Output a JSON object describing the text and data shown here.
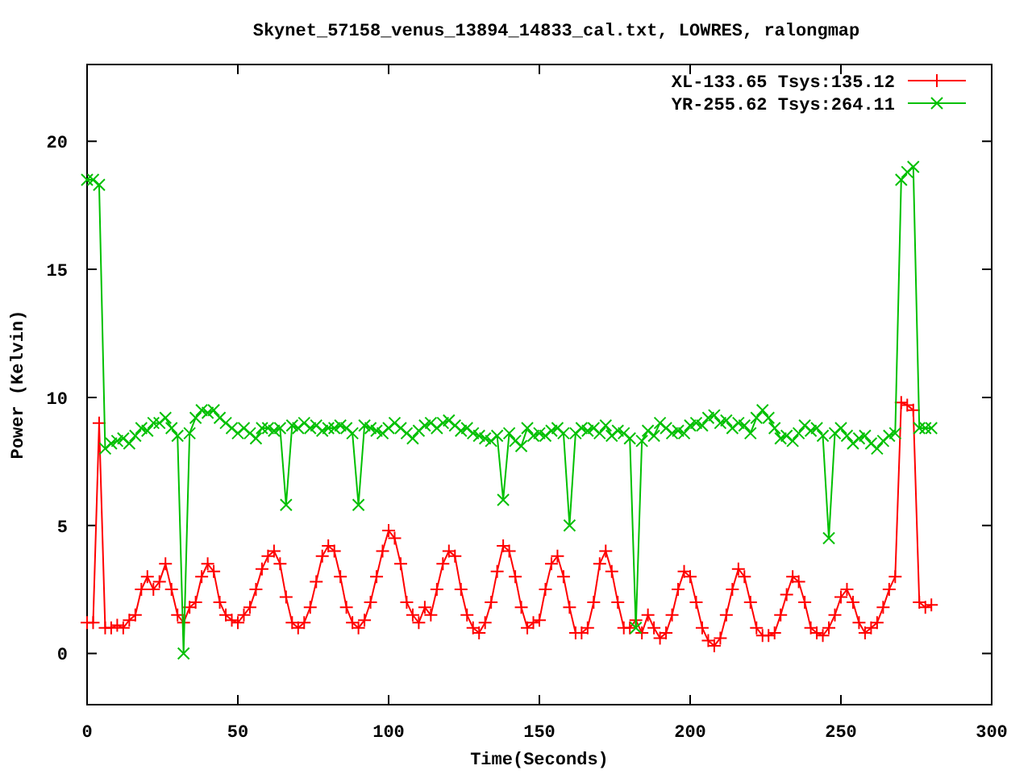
{
  "chart_data": {
    "type": "line",
    "title": "Skynet_57158_venus_13894_14833_cal.txt, LOWRES, ralongmap",
    "xlabel": "Time(Seconds)",
    "ylabel": "Power (Kelvin)",
    "x": [
      0,
      2,
      4,
      6,
      8,
      10,
      12,
      14,
      16,
      18,
      20,
      22,
      24,
      26,
      28,
      30,
      32,
      34,
      36,
      38,
      40,
      42,
      44,
      46,
      48,
      50,
      52,
      54,
      56,
      58,
      60,
      62,
      64,
      66,
      68,
      70,
      72,
      74,
      76,
      78,
      80,
      82,
      84,
      86,
      88,
      90,
      92,
      94,
      96,
      98,
      100,
      102,
      104,
      106,
      108,
      110,
      112,
      114,
      116,
      118,
      120,
      122,
      124,
      126,
      128,
      130,
      132,
      134,
      136,
      138,
      140,
      142,
      144,
      146,
      148,
      150,
      152,
      154,
      156,
      158,
      160,
      162,
      164,
      166,
      168,
      170,
      172,
      174,
      176,
      178,
      180,
      182,
      184,
      186,
      188,
      190,
      192,
      194,
      196,
      198,
      200,
      202,
      204,
      206,
      208,
      210,
      212,
      214,
      216,
      218,
      220,
      222,
      224,
      226,
      228,
      230,
      232,
      234,
      236,
      238,
      240,
      242,
      244,
      246,
      248,
      250,
      252,
      254,
      256,
      258,
      260,
      262,
      264,
      266,
      268,
      270,
      272,
      274,
      276,
      278,
      280
    ],
    "series": [
      {
        "name": "XL-133.65 Tsys:135.12",
        "color": "#ff0000",
        "marker": "plus",
        "values": [
          1.2,
          1.2,
          9.0,
          1.0,
          1.0,
          1.1,
          1.0,
          1.3,
          1.5,
          2.5,
          3.0,
          2.5,
          2.8,
          3.5,
          2.5,
          1.5,
          1.2,
          1.8,
          2.0,
          3.0,
          3.5,
          3.2,
          2.0,
          1.5,
          1.3,
          1.2,
          1.5,
          1.8,
          2.5,
          3.3,
          3.8,
          4.0,
          3.5,
          2.2,
          1.2,
          1.0,
          1.2,
          1.8,
          2.8,
          3.8,
          4.2,
          4.0,
          3.0,
          1.8,
          1.2,
          1.0,
          1.3,
          2.0,
          3.0,
          4.0,
          4.8,
          4.5,
          3.5,
          2.0,
          1.5,
          1.2,
          1.8,
          1.5,
          2.5,
          3.5,
          4.0,
          3.8,
          2.5,
          1.5,
          1.0,
          0.8,
          1.2,
          2.0,
          3.2,
          4.2,
          4.0,
          3.0,
          1.8,
          1.0,
          1.2,
          1.3,
          2.5,
          3.5,
          3.8,
          3.0,
          1.8,
          0.8,
          0.8,
          1.0,
          2.0,
          3.5,
          4.0,
          3.2,
          2.0,
          1.0,
          1.0,
          1.3,
          0.8,
          1.5,
          1.0,
          0.6,
          0.8,
          1.5,
          2.5,
          3.2,
          3.0,
          2.0,
          1.0,
          0.5,
          0.3,
          0.6,
          1.5,
          2.5,
          3.3,
          3.0,
          2.0,
          1.0,
          0.7,
          0.7,
          0.8,
          1.5,
          2.3,
          3.0,
          2.8,
          2.0,
          1.0,
          0.8,
          0.7,
          1.0,
          1.5,
          2.2,
          2.5,
          2.0,
          1.2,
          0.8,
          1.0,
          1.2,
          1.8,
          2.5,
          3.0,
          9.8,
          9.7,
          9.5,
          2.0,
          1.8,
          1.9
        ]
      },
      {
        "name": "YR-255.62 Tsys:264.11",
        "color": "#00c000",
        "marker": "cross",
        "values": [
          18.5,
          18.5,
          18.3,
          8.0,
          8.2,
          8.3,
          8.4,
          8.2,
          8.5,
          8.8,
          8.7,
          9.0,
          9.0,
          9.2,
          8.8,
          8.5,
          0.0,
          8.6,
          9.2,
          9.5,
          9.4,
          9.5,
          9.2,
          9.0,
          8.8,
          8.6,
          8.8,
          8.6,
          8.4,
          8.8,
          8.8,
          8.7,
          8.8,
          5.8,
          8.9,
          8.8,
          9.0,
          8.8,
          8.9,
          8.7,
          8.8,
          8.8,
          8.9,
          8.8,
          8.6,
          5.8,
          8.9,
          8.8,
          8.7,
          8.6,
          8.8,
          9.0,
          8.8,
          8.6,
          8.4,
          8.7,
          8.9,
          9.0,
          8.8,
          9.0,
          9.1,
          8.9,
          8.7,
          8.8,
          8.6,
          8.5,
          8.4,
          8.3,
          8.5,
          6.0,
          8.6,
          8.3,
          8.1,
          8.8,
          8.5,
          8.6,
          8.5,
          8.7,
          8.8,
          8.6,
          5.0,
          8.6,
          8.8,
          8.7,
          8.8,
          8.6,
          8.9,
          8.5,
          8.7,
          8.6,
          8.4,
          1.0,
          8.3,
          8.7,
          8.5,
          9.0,
          8.8,
          8.6,
          8.7,
          8.6,
          8.9,
          9.0,
          8.9,
          9.2,
          9.3,
          9.0,
          9.1,
          8.8,
          9.0,
          8.9,
          8.6,
          9.2,
          9.5,
          9.2,
          8.8,
          8.4,
          8.5,
          8.3,
          8.6,
          8.9,
          8.7,
          8.8,
          8.5,
          4.5,
          8.6,
          8.8,
          8.5,
          8.2,
          8.4,
          8.5,
          8.2,
          8.0,
          8.3,
          8.5,
          8.6,
          18.5,
          18.8,
          19.0,
          8.8,
          8.8,
          8.8
        ]
      }
    ],
    "legend": true,
    "xlim": [
      0,
      300
    ],
    "ylim": [
      -2,
      23
    ],
    "xticks": [
      0,
      50,
      100,
      150,
      200,
      250,
      300
    ],
    "yticks": [
      0,
      5,
      10,
      15,
      20
    ]
  }
}
